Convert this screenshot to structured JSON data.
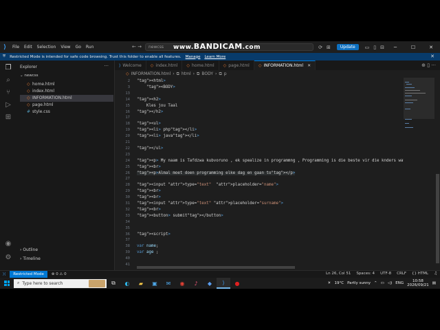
{
  "titlebar": {
    "menu": [
      "File",
      "Edit",
      "Selection",
      "View",
      "Go",
      "Run"
    ],
    "command_center": "newcss",
    "watermark_prefix": "www.",
    "watermark_brand": "BANDICAM",
    "watermark_suffix": ".com",
    "update_label": "Update"
  },
  "banner": {
    "message": "Restricted Mode is intended for safe code browsing. Trust this folder to enable all features.",
    "manage": "Manage",
    "learn_more": "Learn More"
  },
  "sidebar": {
    "title": "Explorer",
    "folder": "newcss",
    "files": [
      {
        "name": "home.html",
        "type": "html"
      },
      {
        "name": "index.html",
        "type": "html"
      },
      {
        "name": "INFORMATION.html",
        "type": "html",
        "active": true
      },
      {
        "name": "page.html",
        "type": "html"
      },
      {
        "name": "style.css",
        "type": "css"
      }
    ],
    "outline": "Outline",
    "timeline": "Timeline"
  },
  "tabs": [
    {
      "label": "Welcome"
    },
    {
      "label": "index.html"
    },
    {
      "label": "home.html"
    },
    {
      "label": "page.html"
    },
    {
      "label": "INFORMATION.html",
      "active": true
    }
  ],
  "breadcrumb": [
    "INFORMATION.html",
    "html",
    "BODY",
    "p"
  ],
  "editor": {
    "lines": [
      {
        "n": "2",
        "text": "<html>"
      },
      {
        "n": "3",
        "text": "    <BODY>"
      },
      {
        "n": "13",
        "text": ""
      },
      {
        "n": "14",
        "text": "<h2>"
      },
      {
        "n": "15",
        "text": "    Kles jou Taal"
      },
      {
        "n": "16",
        "text": "</h2>"
      },
      {
        "n": "17",
        "text": ""
      },
      {
        "n": "18",
        "text": "<ul>"
      },
      {
        "n": "19",
        "text": "<li> php</li>"
      },
      {
        "n": "20",
        "text": "<li> java</li>"
      },
      {
        "n": "21",
        "text": ""
      },
      {
        "n": "22",
        "text": "</ul>"
      },
      {
        "n": "23",
        "text": ""
      },
      {
        "n": "24",
        "text": "<p> My naam is Tafdzwa kubvoruno , ek spealize in programmng , Programming is die beste vir die knders wat die toekm"
      },
      {
        "n": "25",
        "text": "<br>"
      },
      {
        "n": "26",
        "text": "<p>Almal moet doen programming elke dag en gaan to</p>"
      },
      {
        "n": "27",
        "text": ""
      },
      {
        "n": "28",
        "text": "<input type=\"text\"  placeholder=\"name\">"
      },
      {
        "n": "29",
        "text": "<br>"
      },
      {
        "n": "30",
        "text": "<br>"
      },
      {
        "n": "31",
        "text": "<input type=\"text\" placeholder=\"surname\">"
      },
      {
        "n": "32",
        "text": "<br>"
      },
      {
        "n": "33",
        "text": "<button> submit</button>"
      },
      {
        "n": "34",
        "text": ""
      },
      {
        "n": "35",
        "text": ""
      },
      {
        "n": "36",
        "text": "<script>"
      },
      {
        "n": "37",
        "text": ""
      },
      {
        "n": "38",
        "text": "var name;"
      },
      {
        "n": "39",
        "text": "var age ;"
      },
      {
        "n": "40",
        "text": ""
      },
      {
        "n": "41",
        "text": ""
      }
    ]
  },
  "status": {
    "restricted": "Restricted Mode",
    "problems": "⊗ 0 ⚠ 0",
    "position": "Ln 26, Col 51",
    "spaces": "Spaces: 4",
    "encoding": "UTF-8",
    "eol": "CRLF",
    "language": "{} HTML"
  },
  "taskbar": {
    "search_placeholder": "Type here to search",
    "temperature": "19°C",
    "weather": "Partly sunny",
    "language": "ENG",
    "time": "10:58",
    "date": "2026/09/21"
  },
  "colors": {
    "accent": "#0078d4",
    "editor_bg": "#1e1e1e",
    "banner_bg": "#083b6b"
  }
}
